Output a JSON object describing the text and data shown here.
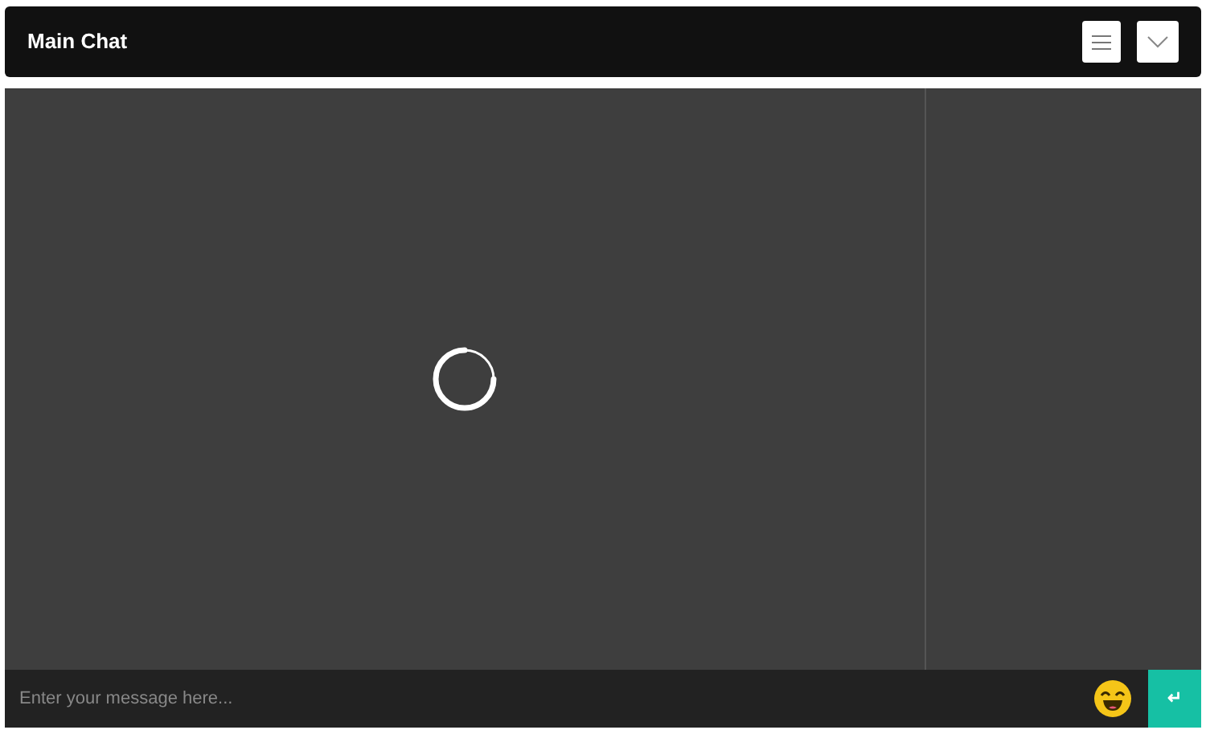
{
  "header": {
    "title": "Main Chat"
  },
  "composer": {
    "placeholder": "Enter your message here...",
    "send_label": "↵"
  }
}
